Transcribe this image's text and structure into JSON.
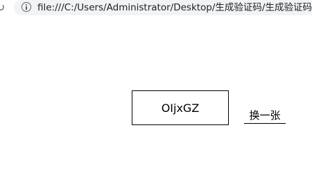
{
  "browser": {
    "url": "file:///C:/Users/Administrator/Desktop/生成验证码/生成验证码"
  },
  "page": {
    "captcha_text": "OIjxGZ",
    "refresh_link": "换一张"
  }
}
